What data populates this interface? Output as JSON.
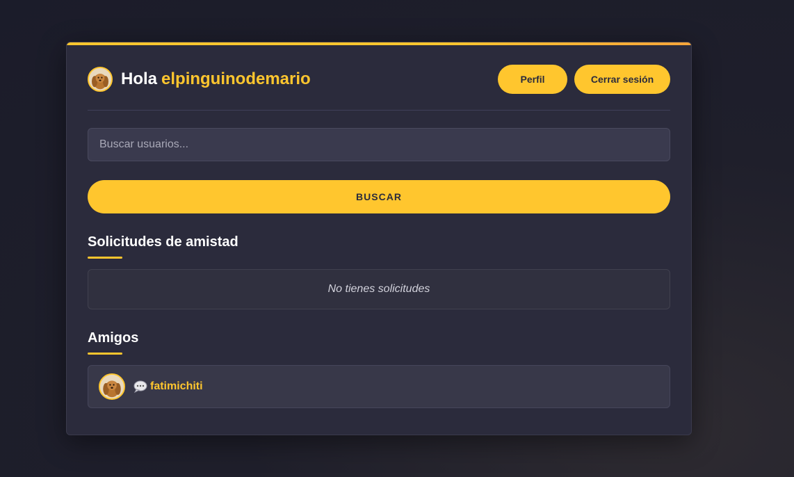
{
  "header": {
    "greeting": "Hola",
    "username": "elpinguinodemario",
    "profile_label": "Perfil",
    "logout_label": "Cerrar sesión"
  },
  "search": {
    "placeholder": "Buscar usuarios...",
    "value": "",
    "button_label": "BUSCAR"
  },
  "requests": {
    "title": "Solicitudes de amistad",
    "empty_text": "No tienes solicitudes"
  },
  "friends": {
    "title": "Amigos",
    "items": [
      {
        "name": "fatimichiti",
        "icon": "chat-bubble-icon"
      }
    ]
  },
  "colors": {
    "accent": "#ffc62e",
    "card_bg": "#2b2b3c",
    "page_bg": "#1d1d2b"
  }
}
